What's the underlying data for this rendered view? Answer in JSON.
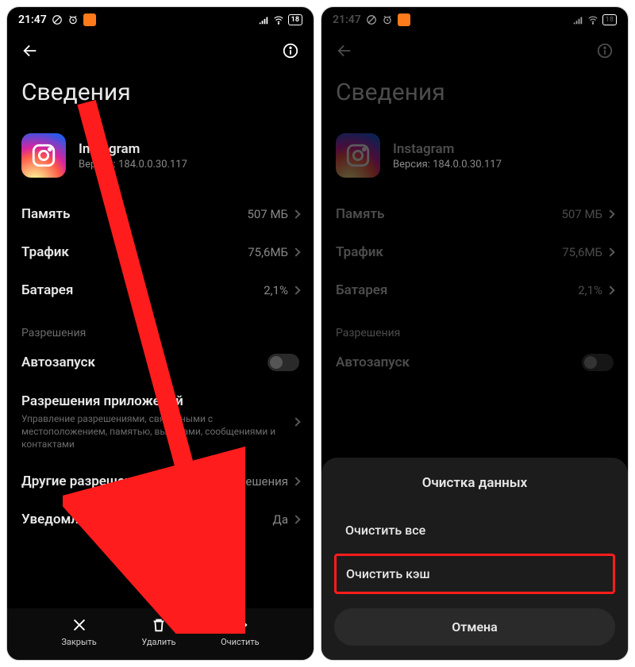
{
  "status": {
    "time": "21:47",
    "battery": "18"
  },
  "left": {
    "title": "Сведения",
    "app": {
      "name": "Instagram",
      "version": "Версия: 184.0.0.30.117"
    },
    "rows": {
      "memory": {
        "label": "Память",
        "value": "507 МБ"
      },
      "traffic": {
        "label": "Трафик",
        "value": "75,6МБ"
      },
      "battery": {
        "label": "Батарея",
        "value": "2,1%"
      }
    },
    "sectionPerms": "Разрешения",
    "autostart": "Автозапуск",
    "appPerms": {
      "label": "Разрешения приложений",
      "desc": "Управление разрешениями, связанными с местоположением, памятью, вызовами, сообщениями и контактами"
    },
    "otherPerms": {
      "label": "Другие разрешения",
      "value": "4 разрешения"
    },
    "notifications": {
      "label": "Уведомления",
      "value": "Да"
    },
    "actions": {
      "close": "Закрыть",
      "delete": "Удалить",
      "clear": "Очистить"
    }
  },
  "right": {
    "title": "Сведения",
    "app": {
      "name": "Instagram",
      "version": "Версия: 184.0.0.30.117"
    },
    "rows": {
      "memory": {
        "label": "Память",
        "value": "507 МБ"
      },
      "traffic": {
        "label": "Трафик",
        "value": "75,6МБ"
      },
      "battery": {
        "label": "Батарея",
        "value": "2,1%"
      }
    },
    "sectionPerms": "Разрешения",
    "autostart": "Автозапуск",
    "sheet": {
      "title": "Очистка данных",
      "clearAll": "Очистить все",
      "clearCache": "Очистить кэш",
      "cancel": "Отмена"
    }
  },
  "colors": {
    "highlight": "#ff1c1c",
    "arrow": "#ff1c1c"
  }
}
